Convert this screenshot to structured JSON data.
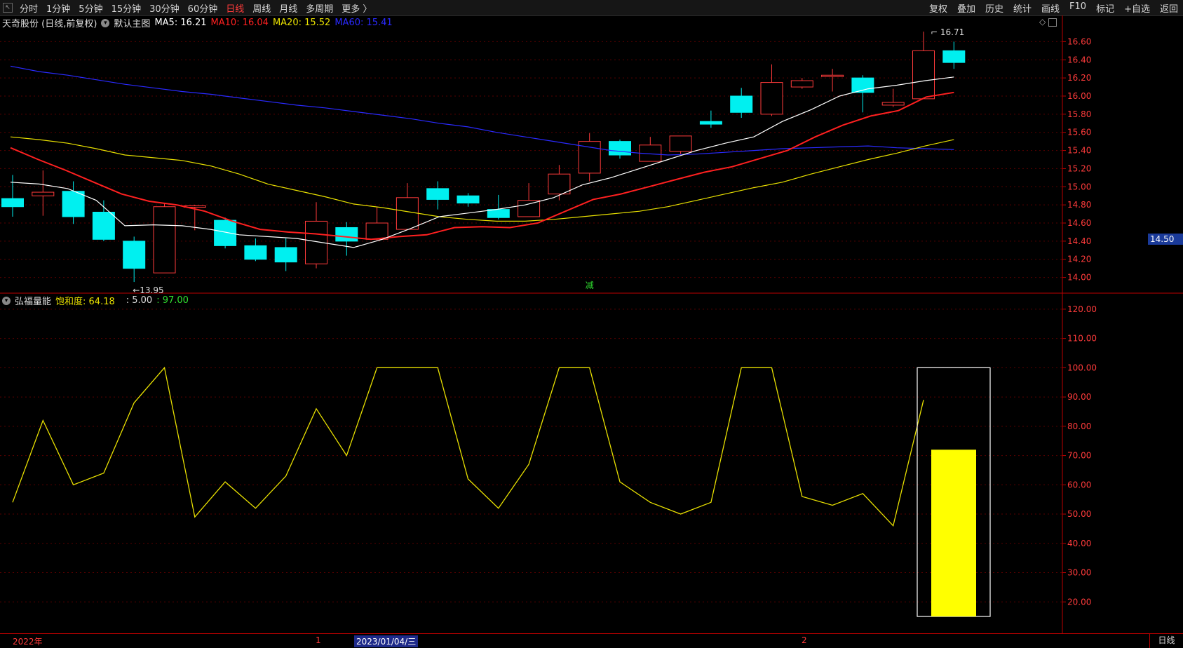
{
  "toolbar": {
    "periods": [
      {
        "label": "分时",
        "active": false
      },
      {
        "label": "1分钟",
        "active": false
      },
      {
        "label": "5分钟",
        "active": false
      },
      {
        "label": "15分钟",
        "active": false
      },
      {
        "label": "30分钟",
        "active": false
      },
      {
        "label": "60分钟",
        "active": false
      },
      {
        "label": "日线",
        "active": true
      },
      {
        "label": "周线",
        "active": false
      },
      {
        "label": "月线",
        "active": false
      },
      {
        "label": "多周期",
        "active": false
      },
      {
        "label": "更多 〉",
        "active": false
      }
    ],
    "right_items": [
      "复权",
      "叠加",
      "历史",
      "统计",
      "画线",
      "F10",
      "标记",
      "+自选",
      "返回"
    ]
  },
  "main_chart": {
    "stock_title": "天奇股份 (日线,前复权)",
    "template": "默认主图",
    "ma_labels": [
      {
        "text": "MA5: 16.21",
        "color": "#ffffff"
      },
      {
        "text": "MA10: 16.04",
        "color": "#ff2020"
      },
      {
        "text": "MA20: 15.52",
        "color": "#e8e000"
      },
      {
        "text": "MA60: 15.41",
        "color": "#2a2aff"
      }
    ],
    "high_label": "16.71",
    "low_label": "13.95",
    "current_price": "14.50",
    "marker_text": "减",
    "y_ticks": [
      "16.60",
      "16.40",
      "16.20",
      "16.00",
      "15.80",
      "15.60",
      "15.40",
      "15.20",
      "15.00",
      "14.80",
      "14.60",
      "14.40",
      "14.20",
      "14.00"
    ]
  },
  "indicator": {
    "name": "弘福量能",
    "saturation_label": "饱和度: 64.18",
    "param1": ": 5.00",
    "param2": ": 97.00",
    "y_ticks": [
      "120.00",
      "110.00",
      "100.00",
      "90.00",
      "80.00",
      "70.00",
      "60.00",
      "50.00",
      "40.00",
      "30.00",
      "20.00"
    ]
  },
  "date_axis": {
    "labels": [
      {
        "text": "2022年",
        "color": "#ff3b3b",
        "badge": false
      },
      {
        "text": "1",
        "color": "#ff3b3b",
        "badge": false
      },
      {
        "text": "2023/01/04/三",
        "color": "#ffffff",
        "badge": true
      },
      {
        "text": "2",
        "color": "#ff3b3b",
        "badge": false
      }
    ],
    "period_label": "日线"
  },
  "colors": {
    "up": "#ff3b3b",
    "down": "#00f0f0",
    "ma5": "#ffffff",
    "ma10": "#ff2020",
    "ma20": "#e8e000",
    "ma60": "#2a2aff",
    "indicator_line": "#e8e000",
    "indicator_bar": "#ffff00"
  },
  "chart_data": [
    {
      "type": "candlestick",
      "ylim": [
        13.85,
        16.75
      ],
      "candles": [
        {
          "o": 14.87,
          "h": 15.13,
          "l": 14.67,
          "c": 14.78
        },
        {
          "o": 14.9,
          "h": 15.18,
          "l": 14.68,
          "c": 14.94
        },
        {
          "o": 14.95,
          "h": 15.06,
          "l": 14.59,
          "c": 14.67
        },
        {
          "o": 14.72,
          "h": 14.85,
          "l": 14.4,
          "c": 14.42
        },
        {
          "o": 14.4,
          "h": 14.45,
          "l": 13.95,
          "c": 14.1
        },
        {
          "o": 14.05,
          "h": 14.82,
          "l": 14.05,
          "c": 14.78
        },
        {
          "o": 14.78,
          "h": 14.8,
          "l": 14.52,
          "c": 14.79
        },
        {
          "o": 14.63,
          "h": 14.66,
          "l": 14.32,
          "c": 14.35
        },
        {
          "o": 14.35,
          "h": 14.43,
          "l": 14.18,
          "c": 14.2
        },
        {
          "o": 14.33,
          "h": 14.43,
          "l": 14.07,
          "c": 14.17
        },
        {
          "o": 14.15,
          "h": 14.83,
          "l": 14.1,
          "c": 14.62
        },
        {
          "o": 14.55,
          "h": 14.61,
          "l": 14.24,
          "c": 14.4
        },
        {
          "o": 14.42,
          "h": 14.78,
          "l": 14.4,
          "c": 14.6
        },
        {
          "o": 14.53,
          "h": 15.04,
          "l": 14.53,
          "c": 14.88
        },
        {
          "o": 14.98,
          "h": 15.06,
          "l": 14.75,
          "c": 14.86
        },
        {
          "o": 14.9,
          "h": 14.93,
          "l": 14.78,
          "c": 14.82
        },
        {
          "o": 14.75,
          "h": 14.91,
          "l": 14.64,
          "c": 14.66
        },
        {
          "o": 14.67,
          "h": 15.04,
          "l": 14.67,
          "c": 14.85
        },
        {
          "o": 14.92,
          "h": 15.24,
          "l": 14.85,
          "c": 15.14
        },
        {
          "o": 15.15,
          "h": 15.59,
          "l": 15.06,
          "c": 15.5
        },
        {
          "o": 15.5,
          "h": 15.52,
          "l": 15.31,
          "c": 15.35
        },
        {
          "o": 15.28,
          "h": 15.55,
          "l": 15.28,
          "c": 15.46
        },
        {
          "o": 15.39,
          "h": 15.56,
          "l": 15.36,
          "c": 15.56
        },
        {
          "o": 15.72,
          "h": 15.84,
          "l": 15.65,
          "c": 15.69
        },
        {
          "o": 16.0,
          "h": 16.09,
          "l": 15.76,
          "c": 15.82
        },
        {
          "o": 15.8,
          "h": 16.35,
          "l": 15.78,
          "c": 16.15
        },
        {
          "o": 16.1,
          "h": 16.2,
          "l": 16.08,
          "c": 16.17
        },
        {
          "o": 16.22,
          "h": 16.3,
          "l": 16.05,
          "c": 16.23
        },
        {
          "o": 16.2,
          "h": 16.23,
          "l": 15.82,
          "c": 16.04
        },
        {
          "o": 15.9,
          "h": 16.08,
          "l": 15.88,
          "c": 15.93
        },
        {
          "o": 15.97,
          "h": 16.71,
          "l": 15.97,
          "c": 16.5
        },
        {
          "o": 16.5,
          "h": 16.6,
          "l": 16.3,
          "c": 16.37
        }
      ],
      "ma5": [
        15.05,
        15.03,
        14.98,
        14.85,
        14.57,
        14.58,
        14.57,
        14.53,
        14.47,
        14.45,
        14.43,
        14.38,
        14.33,
        14.42,
        14.54,
        14.67,
        14.71,
        14.75,
        14.8,
        14.88,
        15.02,
        15.1,
        15.2,
        15.3,
        15.4,
        15.48,
        15.55,
        15.72,
        15.85,
        16.0,
        16.08,
        16.12,
        16.17,
        16.21
      ],
      "ma10": [
        15.43,
        15.3,
        15.18,
        15.05,
        14.92,
        14.84,
        14.8,
        14.73,
        14.62,
        14.53,
        14.5,
        14.48,
        14.45,
        14.42,
        14.45,
        14.47,
        14.55,
        14.56,
        14.55,
        14.6,
        14.73,
        14.86,
        14.92,
        15.0,
        15.08,
        15.16,
        15.22,
        15.31,
        15.4,
        15.55,
        15.68,
        15.78,
        15.84,
        15.99,
        16.04
      ],
      "ma20": [
        15.55,
        15.52,
        15.48,
        15.42,
        15.35,
        15.32,
        15.29,
        15.23,
        15.14,
        15.03,
        14.96,
        14.89,
        14.81,
        14.77,
        14.72,
        14.67,
        14.64,
        14.62,
        14.62,
        14.64,
        14.67,
        14.7,
        14.73,
        14.78,
        14.85,
        14.92,
        14.99,
        15.05,
        15.14,
        15.22,
        15.3,
        15.37,
        15.45,
        15.52
      ],
      "ma60": [
        16.33,
        16.27,
        16.23,
        16.18,
        16.13,
        16.09,
        16.05,
        16.02,
        15.98,
        15.94,
        15.9,
        15.87,
        15.83,
        15.79,
        15.75,
        15.7,
        15.66,
        15.6,
        15.55,
        15.5,
        15.45,
        15.4,
        15.37,
        15.35,
        15.36,
        15.38,
        15.4,
        15.42,
        15.43,
        15.44,
        15.45,
        15.43,
        15.42,
        15.41
      ]
    },
    {
      "type": "line",
      "ylim": [
        10,
        125
      ],
      "series": [
        {
          "values": [
            54,
            82,
            60,
            64,
            88,
            100,
            49,
            61,
            52,
            63,
            86,
            70,
            100,
            100,
            100,
            62,
            52,
            67,
            100,
            100,
            61,
            54,
            50,
            54,
            100,
            100,
            56,
            53,
            57,
            46,
            89
          ]
        }
      ],
      "bar": {
        "value": 72
      }
    }
  ]
}
